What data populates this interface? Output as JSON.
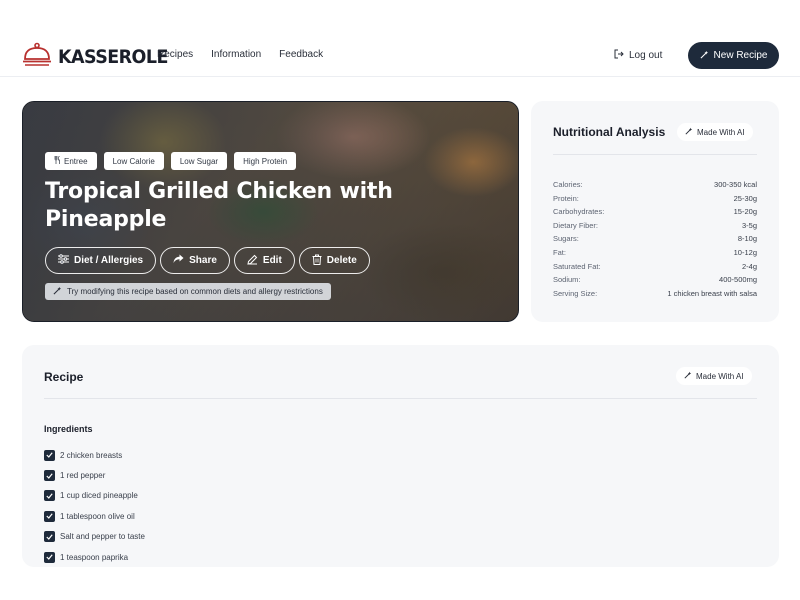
{
  "app": {
    "brand": "KASSEROLE",
    "colors": {
      "primary": "#1e2a3b",
      "card_bg": "#f6f7f9",
      "divider": "#e3e5ea"
    }
  },
  "nav": {
    "items": [
      {
        "label": "Recipes"
      },
      {
        "label": "Information"
      },
      {
        "label": "Feedback"
      }
    ],
    "logout_label": "Log out",
    "new_recipe_label": "New Recipe"
  },
  "hero": {
    "tags": [
      {
        "label": "Entree",
        "icon": "utensils-icon"
      },
      {
        "label": "Low Calorie"
      },
      {
        "label": "Low Sugar"
      },
      {
        "label": "High Protein"
      }
    ],
    "title": "Tropical Grilled Chicken with Pineapple",
    "actions": [
      {
        "label": "Diet / Allergies",
        "icon": "sliders-icon"
      },
      {
        "label": "Share",
        "icon": "share-icon"
      },
      {
        "label": "Edit",
        "icon": "pencil-icon"
      },
      {
        "label": "Delete",
        "icon": "trash-icon"
      }
    ],
    "hint": "Try modifying this recipe based on common diets and allergy restrictions"
  },
  "nutrition": {
    "title": "Nutritional Analysis",
    "badge": "Made With AI",
    "rows": [
      {
        "label": "Calories:",
        "value": "300-350 kcal"
      },
      {
        "label": "Protein:",
        "value": "25-30g"
      },
      {
        "label": "Carbohydrates:",
        "value": "15-20g"
      },
      {
        "label": "Dietary Fiber:",
        "value": "3-5g"
      },
      {
        "label": "Sugars:",
        "value": "8-10g"
      },
      {
        "label": "Fat:",
        "value": "10-12g"
      },
      {
        "label": "Saturated Fat:",
        "value": "2-4g"
      },
      {
        "label": "Sodium:",
        "value": "400-500mg"
      },
      {
        "label": "Serving Size:",
        "value": "1 chicken breast with salsa"
      }
    ]
  },
  "recipe": {
    "title": "Recipe",
    "badge": "Made With AI",
    "ingredients_label": "Ingredients",
    "ingredients": [
      {
        "text": "2 chicken breasts",
        "checked": true
      },
      {
        "text": "1 red pepper",
        "checked": true
      },
      {
        "text": "1 cup diced pineapple",
        "checked": true
      },
      {
        "text": "1 tablespoon olive oil",
        "checked": true
      },
      {
        "text": "Salt and pepper to taste",
        "checked": true
      },
      {
        "text": "1 teaspoon paprika",
        "checked": true
      }
    ]
  }
}
